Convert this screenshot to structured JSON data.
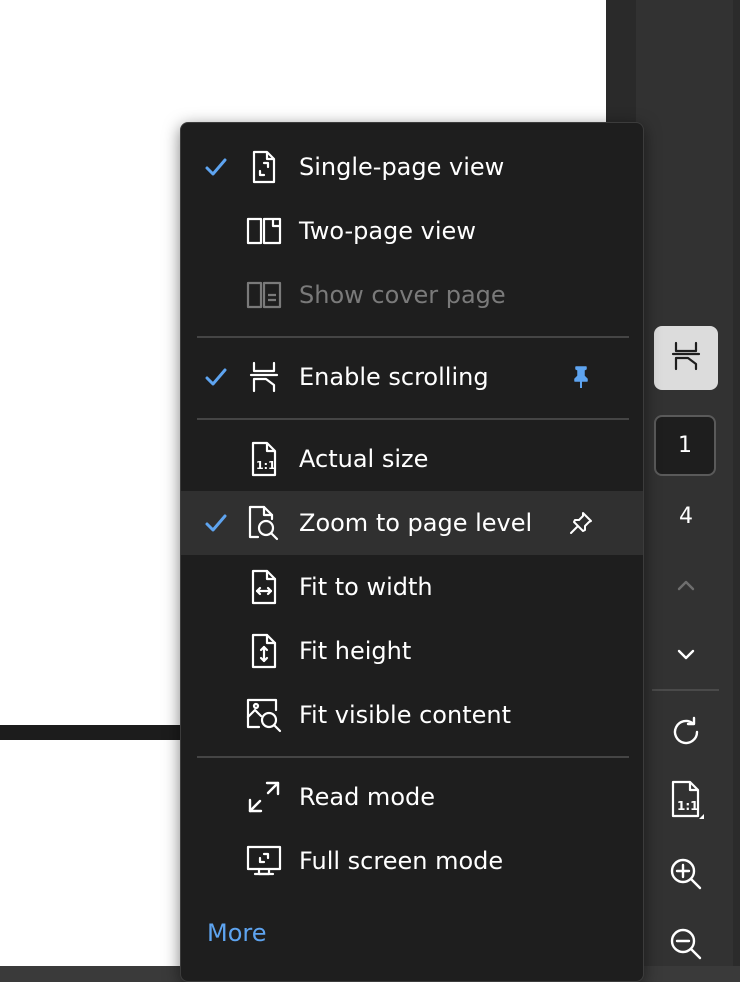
{
  "menu": {
    "items": [
      {
        "label": "Single-page view",
        "checked": true,
        "icon": "single-page-icon"
      },
      {
        "label": "Two-page view",
        "checked": false,
        "icon": "two-page-icon"
      },
      {
        "label": "Show cover page",
        "checked": false,
        "disabled": true,
        "icon": "cover-page-icon"
      },
      {
        "label": "Enable scrolling",
        "checked": true,
        "pinned": true,
        "icon": "scroll-icon"
      },
      {
        "label": "Actual size",
        "checked": false,
        "icon": "actual-size-icon"
      },
      {
        "label": "Zoom to page level",
        "checked": true,
        "pinned": false,
        "highlighted": true,
        "icon": "zoom-page-icon"
      },
      {
        "label": "Fit to width",
        "checked": false,
        "icon": "fit-width-icon"
      },
      {
        "label": "Fit height",
        "checked": false,
        "icon": "fit-height-icon"
      },
      {
        "label": "Fit visible content",
        "checked": false,
        "icon": "fit-visible-icon"
      },
      {
        "label": "Read mode",
        "checked": false,
        "icon": "read-mode-icon"
      },
      {
        "label": "Full screen mode",
        "checked": false,
        "icon": "full-screen-icon"
      }
    ],
    "more_label": "More"
  },
  "rail": {
    "current_page": "1",
    "total_pages": "4",
    "zoom_mode_icon": "actual-size-icon"
  },
  "colors": {
    "accent": "#5ea4f0",
    "menu_bg": "#1e1e1e",
    "highlight": "#303030",
    "disabled": "#7a7a7a"
  }
}
